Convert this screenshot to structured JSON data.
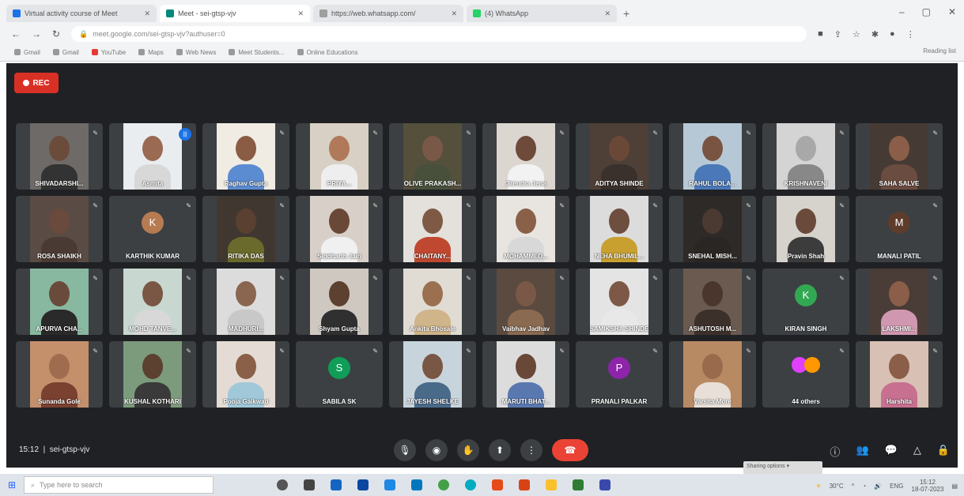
{
  "browser": {
    "tabs": [
      {
        "title": "Virtual activity course of Meet",
        "color": "#1a73e8",
        "active": false
      },
      {
        "title": "Meet - sei-gtsp-vjv",
        "color": "#00897b",
        "active": true
      },
      {
        "title": "https://web.whatsapp.com/",
        "color": "#9e9e9e",
        "active": false
      },
      {
        "title": "(4) WhatsApp",
        "color": "#25d366",
        "active": false
      }
    ],
    "url": "meet.google.com/sei-gtsp-vjv?authuser=0",
    "bookmarks": [
      "Gmail",
      "Gmail",
      "YouTube",
      "Maps",
      "Web News",
      "Meet Students...",
      "Online Educations"
    ],
    "reading_list": "Reading list"
  },
  "meet": {
    "rec_label": "REC",
    "time": "15:12",
    "meeting_code": "sei-gtsp-vjv",
    "participant_count": "44 others",
    "tiles": [
      {
        "name": "SHIVADARSHI...",
        "type": "video",
        "bg": "#6e6a67",
        "skin": "#6b4c3b",
        "shirt": "#333"
      },
      {
        "name": "Asmita",
        "type": "video",
        "bg": "#e9edf0",
        "skin": "#9a6a52",
        "shirt": "#d8d8d8",
        "speaking": true
      },
      {
        "name": "Raghav Gupta",
        "type": "video",
        "bg": "#f0ece4",
        "skin": "#8a5c44",
        "shirt": "#5b8bd0"
      },
      {
        "name": "PRIYA...",
        "type": "video",
        "bg": "#d8d0c4",
        "skin": "#b07a5a",
        "shirt": "#eee"
      },
      {
        "name": "OLIVE PRAKASH...",
        "type": "video",
        "bg": "#54503c",
        "skin": "#7a5848",
        "shirt": "#48503c"
      },
      {
        "name": "Jitendra Jena",
        "type": "video",
        "bg": "#dcd6d0",
        "skin": "#6e4a3a",
        "shirt": "#f2f2f2"
      },
      {
        "name": "ADITYA SHINDE",
        "type": "video",
        "bg": "#4e4036",
        "skin": "#6a4838",
        "shirt": "#3a302c"
      },
      {
        "name": "RAHUL BOLA...",
        "type": "video",
        "bg": "#b6c8d6",
        "skin": "#7a5442",
        "shirt": "#4a78b8"
      },
      {
        "name": "KRISHNAVENI",
        "type": "video",
        "bg": "#d4d4d4",
        "skin": "#a8a8a8",
        "shirt": "#888"
      },
      {
        "name": "SAHA SALVE",
        "type": "video",
        "bg": "#463a34",
        "skin": "#8a5e48",
        "shirt": "#6a4c40"
      },
      {
        "name": "ROSA SHAIKH",
        "type": "video",
        "bg": "#5a4c44",
        "skin": "#6a4a3c",
        "shirt": "#4a3a34"
      },
      {
        "name": "KARTHIK KUMAR",
        "type": "avatar",
        "initial": "K",
        "color": "#b77b52"
      },
      {
        "name": "RITIKA DAS",
        "type": "video",
        "bg": "#403830",
        "skin": "#5a4030",
        "shirt": "#6a6a2c"
      },
      {
        "name": "Siddharth Jain",
        "type": "video",
        "bg": "#d8d0c8",
        "skin": "#6a4838",
        "shirt": "#f0f0f0"
      },
      {
        "name": "CHAITANY...",
        "type": "video",
        "bg": "#e4e0dc",
        "skin": "#7e5a44",
        "shirt": "#c04830"
      },
      {
        "name": "MOHAMMED...",
        "type": "video",
        "bg": "#e8e4e0",
        "skin": "#8a6048",
        "shirt": "#d8d8d8"
      },
      {
        "name": "NEHA BHUMIL...",
        "type": "video",
        "bg": "#dcdcdc",
        "skin": "#6e4e3e",
        "shirt": "#c8a030"
      },
      {
        "name": "SNEHAL MISH...",
        "type": "video",
        "bg": "#2e2a28",
        "skin": "#4a3a32",
        "shirt": "#2a2624"
      },
      {
        "name": "Pravin Shah",
        "type": "video",
        "bg": "#d6d2cc",
        "skin": "#6a4a3a",
        "shirt": "#3c3c3c"
      },
      {
        "name": "MANALI PATIL",
        "type": "avatar",
        "initial": "M",
        "color": "#5e3c2c"
      },
      {
        "name": "APURVA CHA...",
        "type": "video",
        "bg": "#88b8a0",
        "skin": "#6a4a3a",
        "shirt": "#2a2a2a"
      },
      {
        "name": "MOHD TANVE...",
        "type": "video",
        "bg": "#c8d8d0",
        "skin": "#7a5644",
        "shirt": "#d8d8d8"
      },
      {
        "name": "MADHURI...",
        "type": "video",
        "bg": "#dcdcdc",
        "skin": "#8a6650",
        "shirt": "#c8c8c8"
      },
      {
        "name": "Shyam Gupta",
        "type": "video",
        "bg": "#cfc8c0",
        "skin": "#5c4030",
        "shirt": "#303030"
      },
      {
        "name": "Ankita Bhosale",
        "type": "video",
        "bg": "#e0dcd4",
        "skin": "#9a7050",
        "shirt": "#d0b48a"
      },
      {
        "name": "Vaibhav Jadhav",
        "type": "video",
        "bg": "#5a4a40",
        "skin": "#7a5848",
        "shirt": "#8a6a50"
      },
      {
        "name": "SAMIKSHA SHINDE",
        "type": "video",
        "bg": "#e4e4e4",
        "skin": "#7e5846",
        "shirt": "#e8e8e8"
      },
      {
        "name": "ASHUTOSH M...",
        "type": "video",
        "bg": "#6a5a50",
        "skin": "#4a362c",
        "shirt": "#3c302a"
      },
      {
        "name": "KIRAN SINGH",
        "type": "avatar",
        "initial": "K",
        "color": "#33a852"
      },
      {
        "name": "LAKSHMI...",
        "type": "video",
        "bg": "#4a3c36",
        "skin": "#8a5e48",
        "shirt": "#d098b0"
      },
      {
        "name": "Sunanda Gole",
        "type": "video",
        "bg": "#c4906c",
        "skin": "#a06c50",
        "shirt": "#7a4030"
      },
      {
        "name": "KUSHAL KOTHARI",
        "type": "video",
        "bg": "#7c9a7c",
        "skin": "#5c4030",
        "shirt": "#3a3a3a"
      },
      {
        "name": "Pooja Gaikwad",
        "type": "video",
        "bg": "#e4dcd4",
        "skin": "#8a6048",
        "shirt": "#a0c8d8"
      },
      {
        "name": "SABILA SK",
        "type": "avatar",
        "initial": "S",
        "color": "#0f9d58"
      },
      {
        "name": "JAYESH SHELKE",
        "type": "video",
        "bg": "#c8d4dc",
        "skin": "#7a5644",
        "shirt": "#4a6a8a"
      },
      {
        "name": "MARUTI BHAT...",
        "type": "video",
        "bg": "#dcdcdc",
        "skin": "#6a4838",
        "shirt": "#5a78b0"
      },
      {
        "name": "PRANALI PALKAR",
        "type": "avatar",
        "initial": "P",
        "color": "#8e24aa"
      },
      {
        "name": "Varsha More",
        "type": "video",
        "bg": "#b88a64",
        "skin": "#9a6a4c",
        "shirt": "#e8e0d8"
      },
      {
        "name": "44 others",
        "type": "others",
        "colors": [
          "#e040fb",
          "#ff9800"
        ]
      },
      {
        "name": "Harshita",
        "type": "video",
        "bg": "#d8c0b4",
        "skin": "#8a5e48",
        "shirt": "#c87090"
      }
    ]
  },
  "taskbar": {
    "search_placeholder": "Type here to search",
    "temp": "30°C",
    "lang": "ENG",
    "clock_time": "15:12",
    "clock_date": "18-07-2023",
    "toast": "Sharing options ▾"
  }
}
